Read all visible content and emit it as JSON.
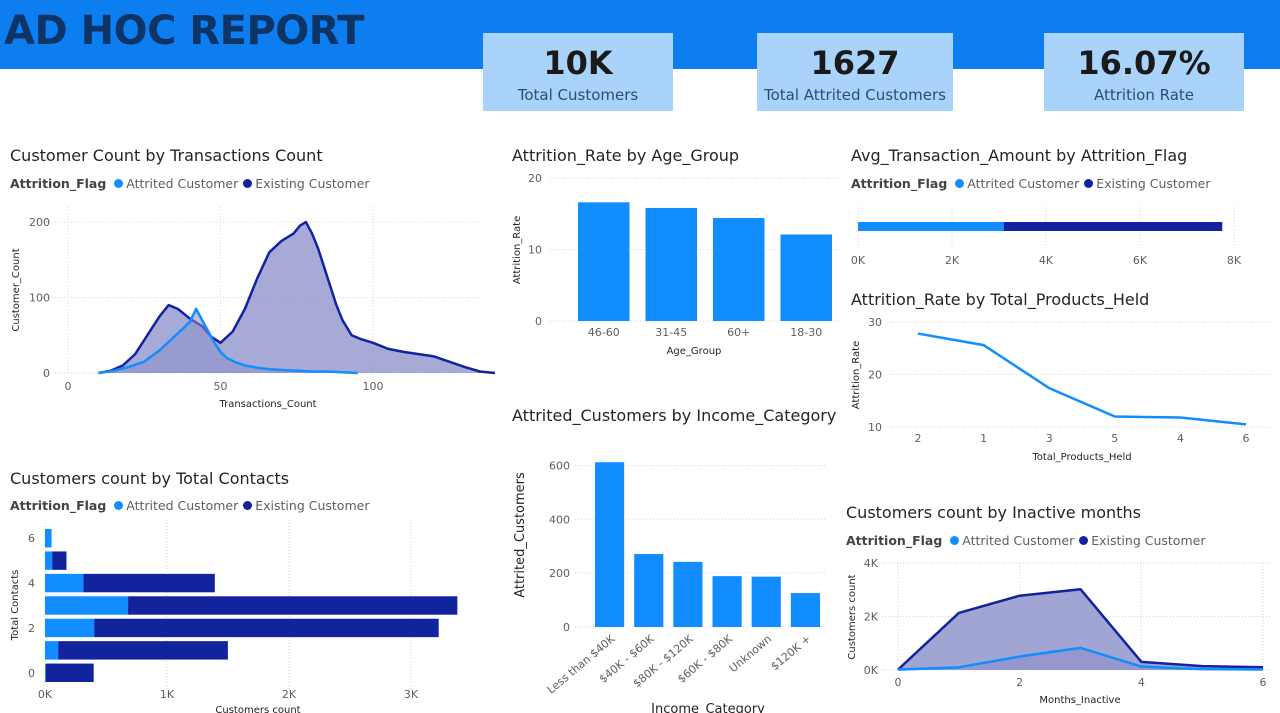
{
  "header": {
    "title": "AD HOC REPORT"
  },
  "kpis": [
    {
      "value": "10K",
      "label": "Total Customers"
    },
    {
      "value": "1627",
      "label": "Total Attrited Customers"
    },
    {
      "value": "16.07%",
      "label": "Attrition Rate"
    }
  ],
  "legend": {
    "field": "Attrition_Flag",
    "attrited": "Attrited Customer",
    "existing": "Existing Customer"
  },
  "colors": {
    "attrited": "#118dff",
    "existing": "#12239e",
    "area_fill": "#8a8ec8",
    "bar": "#118dff",
    "header": "#0c7ef0",
    "kpi_bg": "#a9d3fb"
  },
  "chart_data": [
    {
      "id": "transactions",
      "type": "area",
      "title": "Customer Count by Transactions Count",
      "xlabel": "Transactions_Count",
      "ylabel": "Customer_Count",
      "xlim": [
        0,
        140
      ],
      "ylim": [
        0,
        220
      ],
      "xticks": [
        "0",
        "50",
        "100"
      ],
      "yticks": [
        "0",
        "100",
        "200"
      ],
      "series": [
        {
          "name": "Attrited Customer",
          "x": [
            10,
            15,
            20,
            25,
            30,
            34,
            38,
            40,
            42,
            44,
            46,
            48,
            50,
            52,
            55,
            58,
            62,
            66,
            70,
            75,
            80,
            85,
            90,
            95
          ],
          "y": [
            0,
            3,
            8,
            15,
            30,
            45,
            60,
            68,
            85,
            70,
            55,
            40,
            28,
            20,
            14,
            10,
            7,
            5,
            4,
            3,
            2,
            2,
            1,
            0
          ]
        },
        {
          "name": "Existing Customer",
          "x": [
            10,
            14,
            18,
            22,
            26,
            30,
            33,
            36,
            40,
            44,
            47,
            50,
            54,
            58,
            62,
            66,
            70,
            74,
            76,
            78,
            80,
            82,
            84,
            86,
            88,
            90,
            93,
            96,
            100,
            105,
            110,
            115,
            120,
            125,
            130,
            135,
            140
          ],
          "y": [
            0,
            3,
            10,
            25,
            50,
            75,
            90,
            85,
            72,
            62,
            48,
            40,
            55,
            85,
            125,
            160,
            175,
            185,
            195,
            200,
            185,
            165,
            140,
            115,
            90,
            70,
            50,
            45,
            40,
            32,
            28,
            25,
            22,
            15,
            8,
            2,
            0
          ]
        }
      ]
    },
    {
      "id": "age",
      "type": "bar",
      "title": "Attrition_Rate by Age_Group",
      "xlabel": "Age_Group",
      "ylabel": "Attrition_Rate",
      "ylim": [
        0,
        20
      ],
      "yticks": [
        "0",
        "10",
        "20"
      ],
      "categories": [
        "46-60",
        "31-45",
        "60+",
        "18-30"
      ],
      "values": [
        16.6,
        15.8,
        14.4,
        12.1
      ]
    },
    {
      "id": "avgamt",
      "type": "bar",
      "title": "Avg_Transaction_Amount by Attrition_Flag",
      "xlim": [
        0,
        8000
      ],
      "xticks": [
        "0K",
        "2K",
        "4K",
        "6K",
        "8K"
      ],
      "categories": [
        "Attrited Customer",
        "Existing Customer"
      ],
      "values": [
        3100,
        4650
      ]
    },
    {
      "id": "products",
      "type": "line",
      "title": "Attrition_Rate by Total_Products_Held",
      "xlabel": "Total_Products_Held",
      "ylabel": "Attrition_Rate",
      "ylim": [
        10,
        30
      ],
      "yticks": [
        "10",
        "20",
        "30"
      ],
      "categories": [
        "2",
        "1",
        "3",
        "5",
        "4",
        "6"
      ],
      "values": [
        27.8,
        25.6,
        17.4,
        12.0,
        11.8,
        10.5
      ]
    },
    {
      "id": "income",
      "type": "bar",
      "title": "Attrited_Customers by Income_Category",
      "xlabel": "Income_Category",
      "ylabel": "Attrited_Customers",
      "ylim": [
        0,
        650
      ],
      "yticks": [
        "0",
        "200",
        "400",
        "600"
      ],
      "categories": [
        "Less than $40K",
        "$40K - $60K",
        "$80K - $120K",
        "$60K - $80K",
        "Unknown",
        "$120K +"
      ],
      "values": [
        612,
        271,
        242,
        189,
        187,
        126
      ]
    },
    {
      "id": "contacts",
      "type": "bar",
      "title": "Customers count by Total Contacts",
      "xlabel": "Customers count",
      "ylabel": "Total Contacts",
      "xlim": [
        0,
        3500
      ],
      "xticks": [
        "0K",
        "1K",
        "2K",
        "3K"
      ],
      "yticks": [
        "0",
        "2",
        "4",
        "6"
      ],
      "categories": [
        "6",
        "5",
        "4",
        "3",
        "2",
        "1",
        "0"
      ],
      "series": [
        {
          "name": "Attrited Customer",
          "values": [
            54,
            59,
            315,
            681,
            403,
            108,
            7
          ]
        },
        {
          "name": "Existing Customer",
          "values": [
            0,
            117,
            1077,
            2699,
            2824,
            1391,
            392
          ]
        }
      ]
    },
    {
      "id": "inactive",
      "type": "area",
      "title": "Customers count by Inactive months",
      "xlabel": "Months_Inactive",
      "ylabel": "Customers count",
      "xlim": [
        0,
        6
      ],
      "ylim": [
        0,
        4000
      ],
      "xticks": [
        "0",
        "2",
        "4",
        "6"
      ],
      "yticks": [
        "0K",
        "2K",
        "4K"
      ],
      "series": [
        {
          "name": "Attrited Customer",
          "x": [
            0,
            1,
            2,
            3,
            4,
            5,
            6
          ],
          "y": [
            15,
            100,
            505,
            826,
            130,
            32,
            19
          ]
        },
        {
          "name": "Existing Customer",
          "x": [
            0,
            1,
            2,
            3,
            4,
            5,
            6
          ],
          "y": [
            14,
            2133,
            2777,
            3020,
            305,
            146,
            105
          ]
        }
      ]
    }
  ]
}
